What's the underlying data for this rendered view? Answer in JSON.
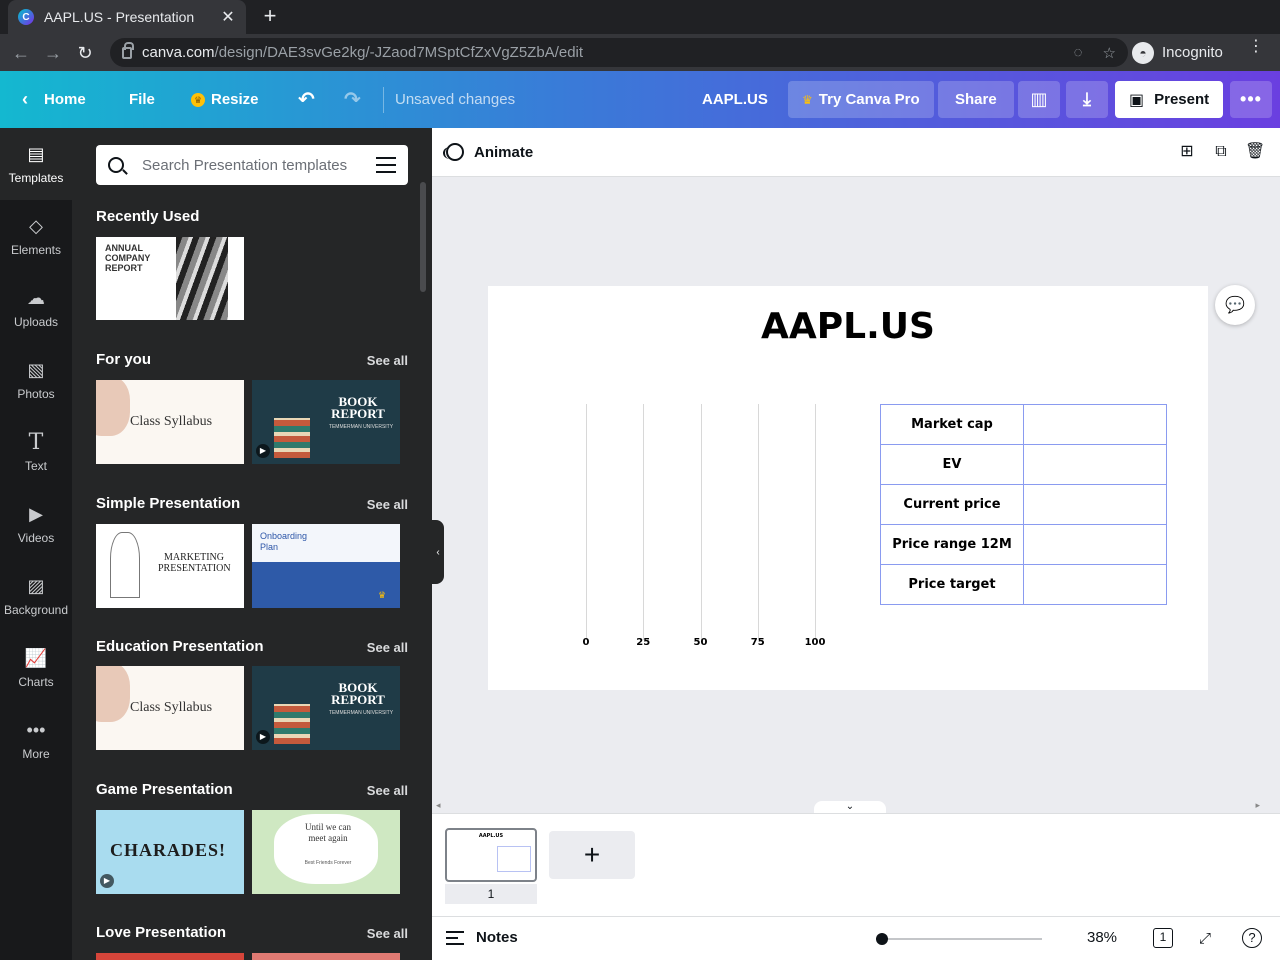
{
  "browser": {
    "tab_title": "AAPL.US - Presentation",
    "tab_favicon": "C",
    "url_host": "canva.com",
    "url_path": "/design/DAE3svGe2kg/-JZaod7MSptCfZxVgZ5ZbA/edit",
    "profile_label": "Incognito"
  },
  "header": {
    "home": "Home",
    "file": "File",
    "resize": "Resize",
    "status": "Unsaved changes",
    "doc_title": "AAPL.US",
    "try_pro": "Try Canva Pro",
    "share": "Share",
    "present": "Present",
    "gradient_start": "#14b8d0",
    "gradient_end": "#6a3fe0"
  },
  "rail": {
    "items": [
      {
        "label": "Templates",
        "icon": "templates-icon"
      },
      {
        "label": "Elements",
        "icon": "elements-icon"
      },
      {
        "label": "Uploads",
        "icon": "uploads-icon"
      },
      {
        "label": "Photos",
        "icon": "photos-icon"
      },
      {
        "label": "Text",
        "icon": "text-icon"
      },
      {
        "label": "Videos",
        "icon": "videos-icon"
      },
      {
        "label": "Background",
        "icon": "background-icon"
      },
      {
        "label": "Charts",
        "icon": "charts-icon"
      },
      {
        "label": "More",
        "icon": "more-icon"
      }
    ]
  },
  "panel": {
    "search_placeholder": "Search Presentation templates",
    "see_all": "See all",
    "sections": [
      {
        "title": "Recently Used"
      },
      {
        "title": "For you"
      },
      {
        "title": "Simple Presentation"
      },
      {
        "title": "Education Presentation"
      },
      {
        "title": "Game Presentation"
      },
      {
        "title": "Love Presentation"
      }
    ],
    "thumbs": {
      "annual": "ANNUAL COMPANY REPORT",
      "class_syllabus": "Class Syllabus",
      "book_report": "BOOK REPORT",
      "book_report_sub": "TEMMERMAN UNIVERSITY",
      "marketing": "MARKETING PRESENTATION",
      "onboarding": "Onboarding Plan",
      "charades": "CHARADES!",
      "until": "Until we can meet again",
      "until_sub": "Best Friends Forever"
    }
  },
  "editor": {
    "animate": "Animate",
    "slide_title": "AAPL.US",
    "table": [
      {
        "label": "Market cap",
        "value": ""
      },
      {
        "label": "EV",
        "value": ""
      },
      {
        "label": "Current price",
        "value": ""
      },
      {
        "label": "Price range 12M",
        "value": ""
      },
      {
        "label": "Price target",
        "value": ""
      }
    ],
    "page_number": "1",
    "notes": "Notes",
    "zoom": "38%",
    "page_count": "1",
    "table_border": "#8a9bf0"
  },
  "chart_data": {
    "type": "bar",
    "categories": [],
    "values": [],
    "xticks": [
      "0",
      "25",
      "50",
      "75",
      "100"
    ],
    "xlim": [
      0,
      100
    ],
    "grid": true
  }
}
